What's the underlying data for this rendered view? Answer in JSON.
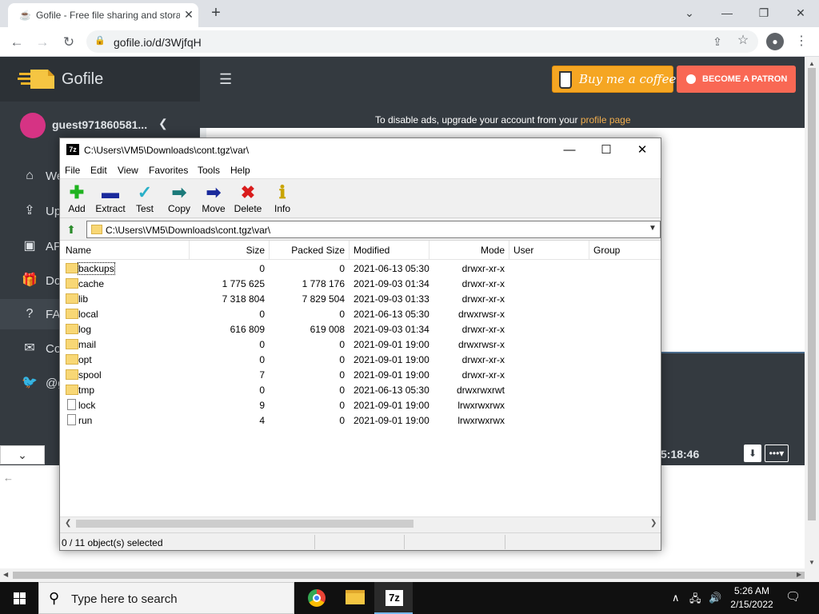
{
  "browser": {
    "tab_title": "Gofile - Free file sharing and storage",
    "tab_close": "✕",
    "new_tab": "+",
    "url": "gofile.io/d/3WjfqH",
    "window_controls": {
      "minimize": "⌄",
      "minimize2": "—",
      "restore": "❐",
      "close": "✕"
    }
  },
  "gofile": {
    "brand": "Gofile",
    "username": "guest971860581...",
    "nav": [
      {
        "label": "We",
        "icon": "home-icon"
      },
      {
        "label": "Up",
        "icon": "upload-icon"
      },
      {
        "label": "AP",
        "icon": "api-icon"
      },
      {
        "label": "Do",
        "icon": "gift-icon"
      },
      {
        "label": "FA",
        "icon": "question-icon"
      },
      {
        "label": "Co",
        "icon": "mail-icon"
      },
      {
        "label": "@g",
        "icon": "twitter-icon"
      }
    ],
    "buy_coffee": "Buy me a coffee",
    "become_patron": "BECOME A PATRON",
    "ads_text": "To disable ads, upgrade your account from your ",
    "ads_link": "profile page",
    "timestamp": "5:18:46"
  },
  "zip": {
    "title": "C:\\Users\\VM5\\Downloads\\cont.tgz\\var\\",
    "menu": [
      "File",
      "Edit",
      "View",
      "Favorites",
      "Tools",
      "Help"
    ],
    "tools": [
      "Add",
      "Extract",
      "Test",
      "Copy",
      "Move",
      "Delete",
      "Info"
    ],
    "address": "C:\\Users\\VM5\\Downloads\\cont.tgz\\var\\",
    "columns": [
      "Name",
      "Size",
      "Packed Size",
      "Modified",
      "Mode",
      "User",
      "Group"
    ],
    "rows": [
      {
        "name": "backups",
        "type": "folder",
        "size": "0",
        "packed": "0",
        "modified": "2021-06-13 05:30",
        "mode": "drwxr-xr-x"
      },
      {
        "name": "cache",
        "type": "folder",
        "size": "1 775 625",
        "packed": "1 778 176",
        "modified": "2021-09-03 01:34",
        "mode": "drwxr-xr-x"
      },
      {
        "name": "lib",
        "type": "folder",
        "size": "7 318 804",
        "packed": "7 829 504",
        "modified": "2021-09-03 01:33",
        "mode": "drwxr-xr-x"
      },
      {
        "name": "local",
        "type": "folder",
        "size": "0",
        "packed": "0",
        "modified": "2021-06-13 05:30",
        "mode": "drwxrwsr-x"
      },
      {
        "name": "log",
        "type": "folder",
        "size": "616 809",
        "packed": "619 008",
        "modified": "2021-09-03 01:34",
        "mode": "drwxr-xr-x"
      },
      {
        "name": "mail",
        "type": "folder",
        "size": "0",
        "packed": "0",
        "modified": "2021-09-01 19:00",
        "mode": "drwxrwsr-x"
      },
      {
        "name": "opt",
        "type": "folder",
        "size": "0",
        "packed": "0",
        "modified": "2021-09-01 19:00",
        "mode": "drwxr-xr-x"
      },
      {
        "name": "spool",
        "type": "folder",
        "size": "7",
        "packed": "0",
        "modified": "2021-09-01 19:00",
        "mode": "drwxr-xr-x"
      },
      {
        "name": "tmp",
        "type": "folder",
        "size": "0",
        "packed": "0",
        "modified": "2021-06-13 05:30",
        "mode": "drwxrwxrwt"
      },
      {
        "name": "lock",
        "type": "file",
        "size": "9",
        "packed": "0",
        "modified": "2021-09-01 19:00",
        "mode": "lrwxrwxrwx"
      },
      {
        "name": "run",
        "type": "file",
        "size": "4",
        "packed": "0",
        "modified": "2021-09-01 19:00",
        "mode": "lrwxrwxrwx"
      }
    ],
    "status": "0 / 11 object(s) selected"
  },
  "taskbar": {
    "search_placeholder": "Type here to search",
    "time": "5:26 AM",
    "date": "2/15/2022"
  }
}
